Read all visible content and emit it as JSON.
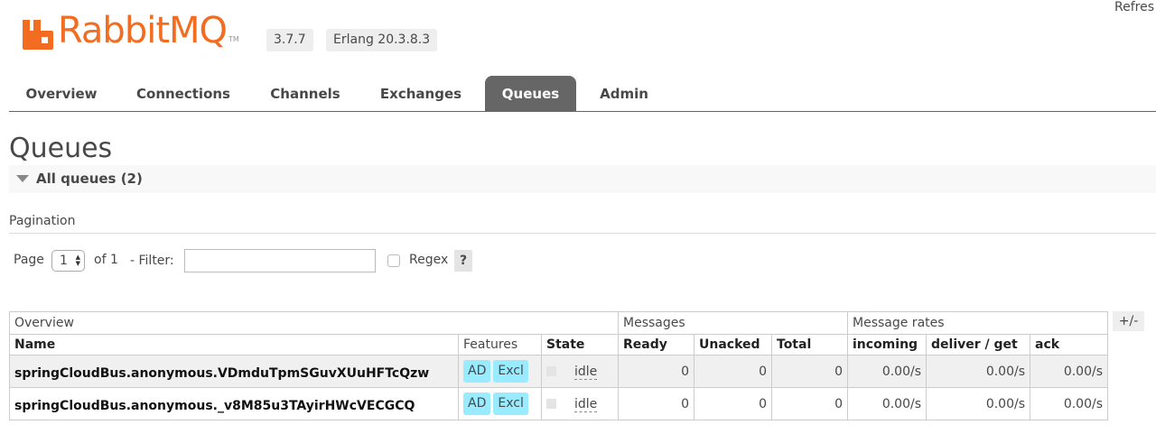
{
  "header": {
    "logo_text": "RabbitMQ",
    "logo_tm": "TM",
    "version": "3.7.7",
    "erlang": "Erlang 20.3.8.3",
    "refresh": "Refres",
    "brand_color": "#f26d21"
  },
  "tabs": [
    {
      "label": "Overview",
      "active": false
    },
    {
      "label": "Connections",
      "active": false
    },
    {
      "label": "Channels",
      "active": false
    },
    {
      "label": "Exchanges",
      "active": false
    },
    {
      "label": "Queues",
      "active": true
    },
    {
      "label": "Admin",
      "active": false
    }
  ],
  "page_title": "Queues",
  "section": {
    "label": "All queues (2)",
    "icon": "triangle-down-icon"
  },
  "pagination": {
    "heading": "Pagination",
    "page_label": "Page",
    "page_value": "1",
    "of_label": "of 1",
    "filter_label": "- Filter:",
    "filter_value": "",
    "regex_label": "Regex",
    "help_label": "?"
  },
  "table": {
    "groups": {
      "overview": "Overview",
      "messages": "Messages",
      "rates": "Message rates",
      "toggle": "+/-"
    },
    "columns": {
      "name": "Name",
      "features": "Features",
      "state": "State",
      "ready": "Ready",
      "unacked": "Unacked",
      "total": "Total",
      "incoming": "incoming",
      "deliver": "deliver / get",
      "ack": "ack"
    },
    "rows": [
      {
        "name": "springCloudBus.anonymous.VDmduTpmSGuvXUuHFTcQzw",
        "feature_ad": "AD",
        "feature_excl": "Excl",
        "state": "idle",
        "ready": "0",
        "unacked": "0",
        "total": "0",
        "incoming": "0.00/s",
        "deliver": "0.00/s",
        "ack": "0.00/s"
      },
      {
        "name": "springCloudBus.anonymous._v8M85u3TAyirHWcVECGCQ",
        "feature_ad": "AD",
        "feature_excl": "Excl",
        "state": "idle",
        "ready": "0",
        "unacked": "0",
        "total": "0",
        "incoming": "0.00/s",
        "deliver": "0.00/s",
        "ack": "0.00/s"
      }
    ]
  }
}
